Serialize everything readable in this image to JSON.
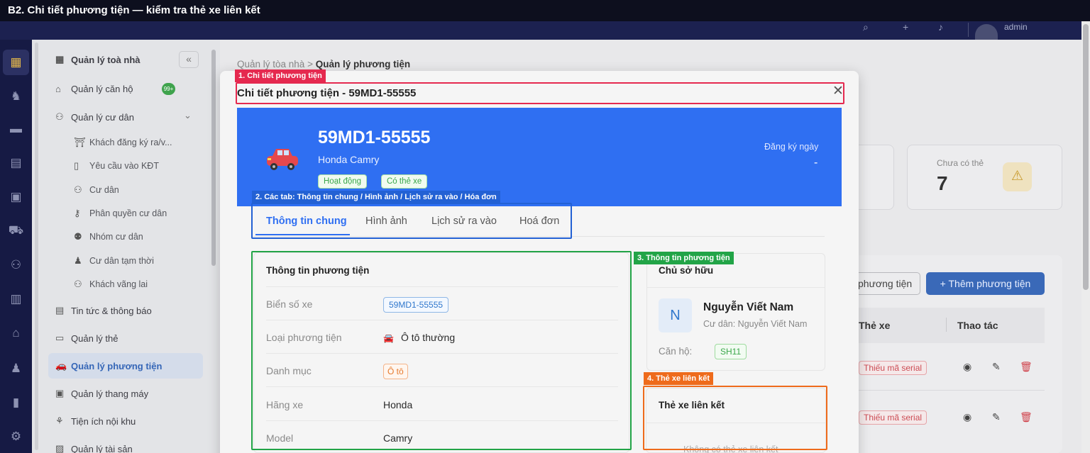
{
  "caption": "B2. Chi tiết phương tiện — kiểm tra thẻ xe liên kết",
  "header": {
    "username": "admin",
    "icons": [
      "search-icon",
      "plus-icon",
      "bell-icon"
    ]
  },
  "rail": {
    "icons": [
      "building-icon",
      "people-icon",
      "chat-icon",
      "calculator-icon",
      "briefcase-icon",
      "car-icon",
      "users-icon",
      "city-icon",
      "store-icon",
      "person-icon",
      "chart-icon",
      "gear-icon"
    ]
  },
  "sidebar": {
    "collapse_symbol": "«",
    "badge": "99+",
    "items": [
      {
        "label": "Quản lý toà nhà",
        "icon": "▦"
      },
      {
        "label": "Quản lý căn hộ",
        "icon": "⌂"
      },
      {
        "label": "Quản lý cư dân",
        "icon": "⚇",
        "chevron": "⌄"
      },
      {
        "label": "Khách đăng ký ra/v...",
        "icon": "⛩"
      },
      {
        "label": "Yêu cầu vào KĐT",
        "icon": "▯"
      },
      {
        "label": "Cư dân",
        "icon": "⚇"
      },
      {
        "label": "Phân quyền cư dân",
        "icon": "⚷"
      },
      {
        "label": "Nhóm cư dân",
        "icon": "⚉"
      },
      {
        "label": "Cư dân tạm thời",
        "icon": "♟"
      },
      {
        "label": "Khách vãng lai",
        "icon": "⚇"
      },
      {
        "label": "Tin tức & thông báo",
        "icon": "▤"
      },
      {
        "label": "Quản lý thẻ",
        "icon": "▭"
      },
      {
        "label": "Quản lý phương tiện",
        "icon": "🚗"
      },
      {
        "label": "Quản lý thang máy",
        "icon": "▣"
      },
      {
        "label": "Tiện ích nội khu",
        "icon": "⚘"
      },
      {
        "label": "Quản lý tài sản",
        "icon": "▨"
      }
    ]
  },
  "page": {
    "breadcrumb_root": "Quản lý tòa nhà",
    "breadcrumb_sep": " > ",
    "breadcrumb_current": "Quản lý phương tiện",
    "stat": {
      "label": "Chưa có thẻ",
      "value": "7",
      "icon": "⚠"
    },
    "btn_search_partial": "phương tiện",
    "btn_add": "+ Thêm phương tiện",
    "col_card": "Thẻ xe",
    "col_actions": "Thao tác",
    "rows": [
      {
        "card_status": "Thiếu mã serial"
      },
      {
        "card_status": "Thiếu mã serial"
      }
    ],
    "action_icons": {
      "view": "◉",
      "edit": "✎",
      "delete": "🗑"
    }
  },
  "modal": {
    "title": "Chi tiết phương tiện - 59MD1-55555",
    "close": "✕",
    "hero": {
      "plate": "59MD1-55555",
      "model": "Honda Camry",
      "status_chip": "Hoạt động",
      "card_chip": "Có thẻ xe",
      "reg_label": "Đăng ký ngày",
      "reg_value": "-"
    },
    "tabs": [
      "Thông tin chung",
      "Hình ảnh",
      "Lịch sử ra vào",
      "Hoá đơn"
    ],
    "vehicle_info": {
      "title": "Thông tin phương tiện",
      "rows": [
        {
          "label": "Biển số xe",
          "value": "59MD1-55555"
        },
        {
          "label": "Loại phương tiện",
          "value": "Ô tô thường",
          "icon": "🚘"
        },
        {
          "label": "Danh mục",
          "value": "Ô tô"
        },
        {
          "label": "Hãng xe",
          "value": "Honda"
        },
        {
          "label": "Model",
          "value": "Camry"
        }
      ]
    },
    "owner": {
      "title": "Chủ sở hữu",
      "initial": "N",
      "name": "Nguyễn Viết Nam",
      "sub": "Cư dân: Nguyễn Viết Nam",
      "apt_label": "Căn hộ:",
      "apt_value": "SH11"
    },
    "linked_card": {
      "title": "Thẻ xe liên kết",
      "empty": "Không có thẻ xe liên kết"
    }
  },
  "annotations": [
    "1. Chi tiết phương tiện",
    "2. Các tab: Thông tin chung / Hình ảnh / Lịch sử ra vào / Hóa đơn",
    "3. Thông tin phương tiện",
    "4. Thẻ xe liên kết"
  ]
}
